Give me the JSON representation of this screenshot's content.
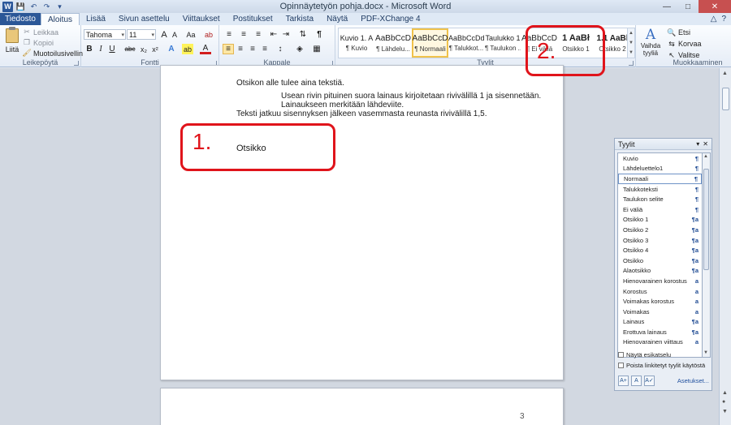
{
  "window": {
    "title": "Opinnäytetyön pohja.docx - Microsoft Word",
    "app_icon": "W",
    "controls": [
      "minimize-icon",
      "maximize-icon",
      "close-icon"
    ]
  },
  "quick_access": [
    "save-icon",
    "undo-icon",
    "redo-icon",
    "customize-icon"
  ],
  "tabs": [
    "Tiedosto",
    "Aloitus",
    "Lisää",
    "Sivun asettelu",
    "Viittaukset",
    "Postitukset",
    "Tarkista",
    "Näytä",
    "PDF-XChange 4"
  ],
  "tabs_right": {
    "expand": "△",
    "help": "?"
  },
  "ribbon": {
    "clipboard": {
      "paste": "Liitä",
      "cut": "Leikkaa",
      "copy": "Kopioi",
      "format_painter": "Muotoilusivellin",
      "label": "Leikepöytä"
    },
    "font": {
      "name": "Tahoma",
      "size": "11",
      "grow": "A",
      "shrink": "A",
      "case": "Aa",
      "clear": "ab",
      "bold": "B",
      "italic": "I",
      "underline": "U",
      "strike": "abc",
      "subscript": "x₂",
      "superscript": "x²",
      "effects": "A",
      "highlight": "ab",
      "color": "A",
      "label": "Fontti"
    },
    "paragraph": {
      "label": "Kappale",
      "pilcrow": "¶"
    },
    "styles": {
      "label": "Tyylit",
      "tiles": [
        {
          "preview": "Kuvio 1.  A",
          "name": "¶ Kuvio"
        },
        {
          "preview": "AaBbCcD",
          "name": "¶ Lähdelu..."
        },
        {
          "preview": "AaBbCcD",
          "name": "¶ Normaali"
        },
        {
          "preview": "AaBbCcDd",
          "name": "¶ Talukkot..."
        },
        {
          "preview": "Taulukko 1",
          "name": "¶ Taulukon ..."
        },
        {
          "preview": "AaBbCcD",
          "name": "¶ Ei väliä"
        },
        {
          "preview": "1 AaBł",
          "name": "Otsikko 1"
        },
        {
          "preview": "1.1  AaBl",
          "name": "Otsikko 2"
        }
      ],
      "change_styles": "Vaihda tyyliä"
    },
    "editing": {
      "label": "Muokkaaminen",
      "find": "Etsi",
      "replace": "Korvaa",
      "select": "Valitse"
    }
  },
  "document": {
    "lines": [
      "Otsikon alle tulee aina tekstiä.",
      "Usean rivin pituinen suora lainaus kirjoitetaan rivivälillä 1 ja sisennetään.",
      "Lainaukseen merkitään lähdeviite.",
      "Teksti jatkuu sisennyksen jälkeen vasemmasta reunasta rivivälillä 1,5.",
      "Otsikko"
    ],
    "page_number": "3"
  },
  "annotations": {
    "box1_label": "1.",
    "box2_label": "2."
  },
  "styles_pane": {
    "title": "Tyylit",
    "items": [
      {
        "name": "Kuvio",
        "sym": "¶"
      },
      {
        "name": "Lähdeluettelo1",
        "sym": "¶"
      },
      {
        "name": "Normaali",
        "sym": "¶"
      },
      {
        "name": "Talukkoteksti",
        "sym": "¶"
      },
      {
        "name": "Taulukon selite",
        "sym": "¶"
      },
      {
        "name": "Ei väliä",
        "sym": "¶"
      },
      {
        "name": "Otsikko 1",
        "sym": "¶a"
      },
      {
        "name": "Otsikko 2",
        "sym": "¶a"
      },
      {
        "name": "Otsikko 3",
        "sym": "¶a"
      },
      {
        "name": "Otsikko 4",
        "sym": "¶a"
      },
      {
        "name": "Otsikko",
        "sym": "¶a"
      },
      {
        "name": "Alaotsikko",
        "sym": "¶a"
      },
      {
        "name": "Hienovarainen korostus",
        "sym": "a"
      },
      {
        "name": "Korostus",
        "sym": "a"
      },
      {
        "name": "Voimakas korostus",
        "sym": "a"
      },
      {
        "name": "Voimakas",
        "sym": "a"
      },
      {
        "name": "Lainaus",
        "sym": "¶a"
      },
      {
        "name": "Erottuva lainaus",
        "sym": "¶a"
      },
      {
        "name": "Hienovarainen viittaus",
        "sym": "a"
      }
    ],
    "show_preview": "Näytä esikatselu",
    "disable_linked": "Poista linkitetyt tyylit käytöstä",
    "options_link": "Asetukset..."
  }
}
